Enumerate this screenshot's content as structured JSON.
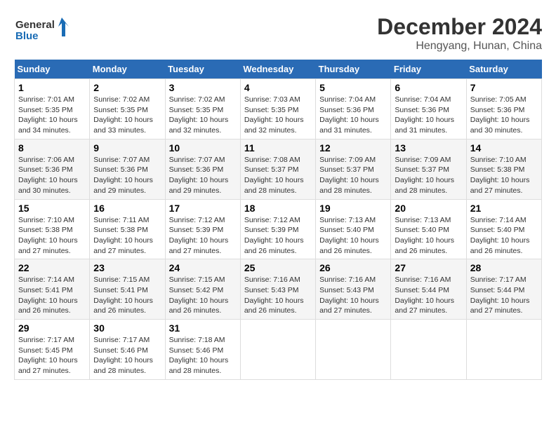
{
  "header": {
    "logo_line1": "General",
    "logo_line2": "Blue",
    "month": "December 2024",
    "location": "Hengyang, Hunan, China"
  },
  "weekdays": [
    "Sunday",
    "Monday",
    "Tuesday",
    "Wednesday",
    "Thursday",
    "Friday",
    "Saturday"
  ],
  "weeks": [
    [
      {
        "day": "1",
        "sunrise": "7:01 AM",
        "sunset": "5:35 PM",
        "daylight": "10 hours and 34 minutes."
      },
      {
        "day": "2",
        "sunrise": "7:02 AM",
        "sunset": "5:35 PM",
        "daylight": "10 hours and 33 minutes."
      },
      {
        "day": "3",
        "sunrise": "7:02 AM",
        "sunset": "5:35 PM",
        "daylight": "10 hours and 32 minutes."
      },
      {
        "day": "4",
        "sunrise": "7:03 AM",
        "sunset": "5:35 PM",
        "daylight": "10 hours and 32 minutes."
      },
      {
        "day": "5",
        "sunrise": "7:04 AM",
        "sunset": "5:36 PM",
        "daylight": "10 hours and 31 minutes."
      },
      {
        "day": "6",
        "sunrise": "7:04 AM",
        "sunset": "5:36 PM",
        "daylight": "10 hours and 31 minutes."
      },
      {
        "day": "7",
        "sunrise": "7:05 AM",
        "sunset": "5:36 PM",
        "daylight": "10 hours and 30 minutes."
      }
    ],
    [
      {
        "day": "8",
        "sunrise": "7:06 AM",
        "sunset": "5:36 PM",
        "daylight": "10 hours and 30 minutes."
      },
      {
        "day": "9",
        "sunrise": "7:07 AM",
        "sunset": "5:36 PM",
        "daylight": "10 hours and 29 minutes."
      },
      {
        "day": "10",
        "sunrise": "7:07 AM",
        "sunset": "5:36 PM",
        "daylight": "10 hours and 29 minutes."
      },
      {
        "day": "11",
        "sunrise": "7:08 AM",
        "sunset": "5:37 PM",
        "daylight": "10 hours and 28 minutes."
      },
      {
        "day": "12",
        "sunrise": "7:09 AM",
        "sunset": "5:37 PM",
        "daylight": "10 hours and 28 minutes."
      },
      {
        "day": "13",
        "sunrise": "7:09 AM",
        "sunset": "5:37 PM",
        "daylight": "10 hours and 28 minutes."
      },
      {
        "day": "14",
        "sunrise": "7:10 AM",
        "sunset": "5:38 PM",
        "daylight": "10 hours and 27 minutes."
      }
    ],
    [
      {
        "day": "15",
        "sunrise": "7:10 AM",
        "sunset": "5:38 PM",
        "daylight": "10 hours and 27 minutes."
      },
      {
        "day": "16",
        "sunrise": "7:11 AM",
        "sunset": "5:38 PM",
        "daylight": "10 hours and 27 minutes."
      },
      {
        "day": "17",
        "sunrise": "7:12 AM",
        "sunset": "5:39 PM",
        "daylight": "10 hours and 27 minutes."
      },
      {
        "day": "18",
        "sunrise": "7:12 AM",
        "sunset": "5:39 PM",
        "daylight": "10 hours and 26 minutes."
      },
      {
        "day": "19",
        "sunrise": "7:13 AM",
        "sunset": "5:40 PM",
        "daylight": "10 hours and 26 minutes."
      },
      {
        "day": "20",
        "sunrise": "7:13 AM",
        "sunset": "5:40 PM",
        "daylight": "10 hours and 26 minutes."
      },
      {
        "day": "21",
        "sunrise": "7:14 AM",
        "sunset": "5:40 PM",
        "daylight": "10 hours and 26 minutes."
      }
    ],
    [
      {
        "day": "22",
        "sunrise": "7:14 AM",
        "sunset": "5:41 PM",
        "daylight": "10 hours and 26 minutes."
      },
      {
        "day": "23",
        "sunrise": "7:15 AM",
        "sunset": "5:41 PM",
        "daylight": "10 hours and 26 minutes."
      },
      {
        "day": "24",
        "sunrise": "7:15 AM",
        "sunset": "5:42 PM",
        "daylight": "10 hours and 26 minutes."
      },
      {
        "day": "25",
        "sunrise": "7:16 AM",
        "sunset": "5:43 PM",
        "daylight": "10 hours and 26 minutes."
      },
      {
        "day": "26",
        "sunrise": "7:16 AM",
        "sunset": "5:43 PM",
        "daylight": "10 hours and 27 minutes."
      },
      {
        "day": "27",
        "sunrise": "7:16 AM",
        "sunset": "5:44 PM",
        "daylight": "10 hours and 27 minutes."
      },
      {
        "day": "28",
        "sunrise": "7:17 AM",
        "sunset": "5:44 PM",
        "daylight": "10 hours and 27 minutes."
      }
    ],
    [
      {
        "day": "29",
        "sunrise": "7:17 AM",
        "sunset": "5:45 PM",
        "daylight": "10 hours and 27 minutes."
      },
      {
        "day": "30",
        "sunrise": "7:17 AM",
        "sunset": "5:46 PM",
        "daylight": "10 hours and 28 minutes."
      },
      {
        "day": "31",
        "sunrise": "7:18 AM",
        "sunset": "5:46 PM",
        "daylight": "10 hours and 28 minutes."
      },
      null,
      null,
      null,
      null
    ]
  ],
  "labels": {
    "sunrise": "Sunrise:",
    "sunset": "Sunset:",
    "daylight": "Daylight:"
  }
}
